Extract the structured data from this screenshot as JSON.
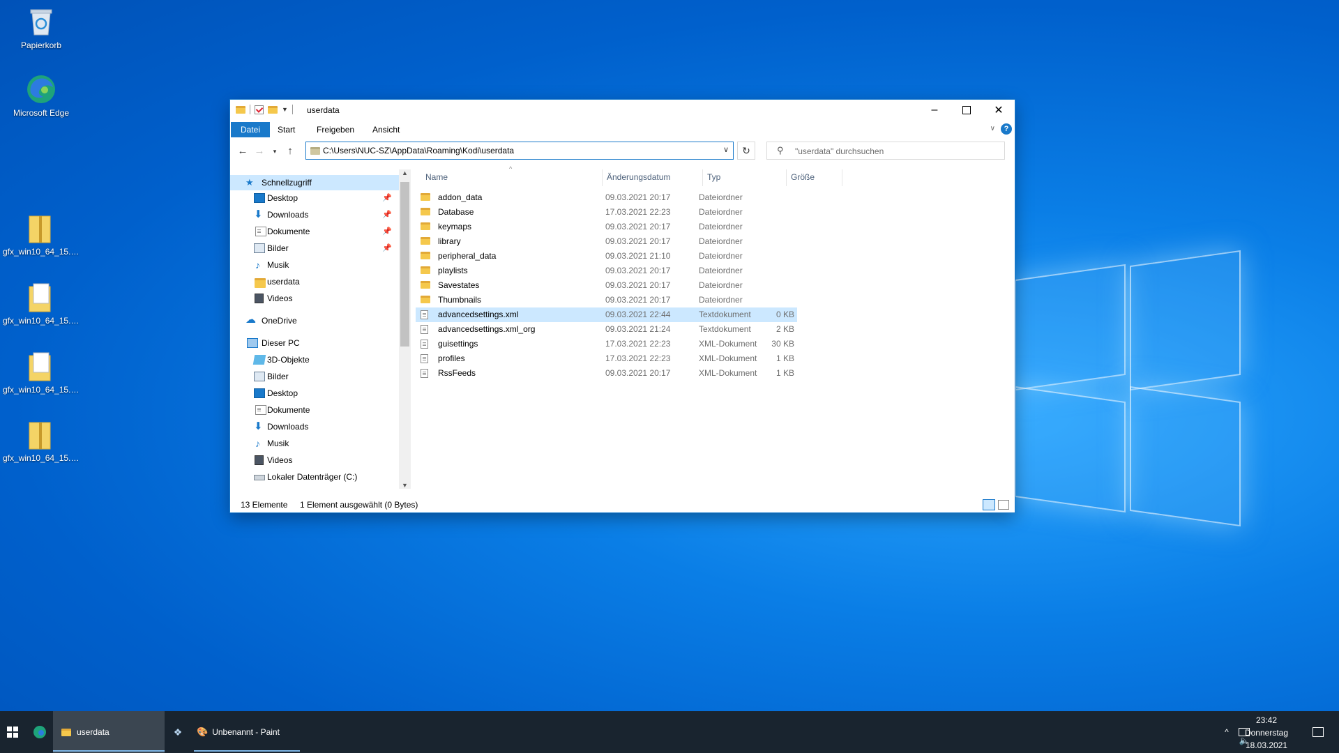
{
  "desktop": {
    "icons": [
      {
        "label": "Papierkorb",
        "icon": "recycle-bin-icon"
      },
      {
        "label": "Microsoft Edge",
        "icon": "edge-icon"
      },
      {
        "label": "gfx_win10_64_15.40...",
        "icon": "zip-folder-icon"
      },
      {
        "label": "gfx_win10_64_15.40...",
        "icon": "zip-folder-icon"
      },
      {
        "label": "gfx_win10_64_15.40...",
        "icon": "zip-folder-icon"
      },
      {
        "label": "gfx_win10_64_15.40...",
        "icon": "zip-folder-icon"
      }
    ]
  },
  "window": {
    "title": "userdata",
    "ribbon_tabs": [
      "Datei",
      "Start",
      "Freigeben",
      "Ansicht"
    ],
    "address": "C:\\Users\\NUC-SZ\\AppData\\Roaming\\Kodi\\userdata",
    "search_placeholder": "\"userdata\" durchsuchen",
    "nav": {
      "quick_access": "Schnellzugriff",
      "quick_items": [
        "Desktop",
        "Downloads",
        "Dokumente",
        "Bilder",
        "Musik",
        "userdata",
        "Videos"
      ],
      "onedrive": "OneDrive",
      "this_pc": "Dieser PC",
      "pc_items": [
        "3D-Objekte",
        "Bilder",
        "Desktop",
        "Dokumente",
        "Downloads",
        "Musik",
        "Videos",
        "Lokaler Datenträger (C:)"
      ]
    },
    "columns": {
      "name": "Name",
      "date": "Änderungsdatum",
      "type": "Typ",
      "size": "Größe"
    },
    "files": [
      {
        "name": "addon_data",
        "date": "09.03.2021 20:17",
        "type": "Dateiordner",
        "size": "",
        "kind": "folder"
      },
      {
        "name": "Database",
        "date": "17.03.2021 22:23",
        "type": "Dateiordner",
        "size": "",
        "kind": "folder"
      },
      {
        "name": "keymaps",
        "date": "09.03.2021 20:17",
        "type": "Dateiordner",
        "size": "",
        "kind": "folder"
      },
      {
        "name": "library",
        "date": "09.03.2021 20:17",
        "type": "Dateiordner",
        "size": "",
        "kind": "folder"
      },
      {
        "name": "peripheral_data",
        "date": "09.03.2021 21:10",
        "type": "Dateiordner",
        "size": "",
        "kind": "folder"
      },
      {
        "name": "playlists",
        "date": "09.03.2021 20:17",
        "type": "Dateiordner",
        "size": "",
        "kind": "folder"
      },
      {
        "name": "Savestates",
        "date": "09.03.2021 20:17",
        "type": "Dateiordner",
        "size": "",
        "kind": "folder"
      },
      {
        "name": "Thumbnails",
        "date": "09.03.2021 20:17",
        "type": "Dateiordner",
        "size": "",
        "kind": "folder"
      },
      {
        "name": "advancedsettings.xml",
        "date": "09.03.2021 22:44",
        "type": "Textdokument",
        "size": "0 KB",
        "kind": "text",
        "selected": true
      },
      {
        "name": "advancedsettings.xml_org",
        "date": "09.03.2021 21:24",
        "type": "Textdokument",
        "size": "2 KB",
        "kind": "text"
      },
      {
        "name": "guisettings",
        "date": "17.03.2021 22:23",
        "type": "XML-Dokument",
        "size": "30 KB",
        "kind": "xml"
      },
      {
        "name": "profiles",
        "date": "17.03.2021 22:23",
        "type": "XML-Dokument",
        "size": "1 KB",
        "kind": "xml"
      },
      {
        "name": "RssFeeds",
        "date": "09.03.2021 20:17",
        "type": "XML-Dokument",
        "size": "1 KB",
        "kind": "xml"
      }
    ],
    "status_count": "13 Elemente",
    "status_selected": "1 Element ausgewählt (0 Bytes)"
  },
  "taskbar": {
    "items": [
      {
        "label": "userdata"
      },
      {
        "label": "Unbenannt - Paint"
      }
    ],
    "time": "23:42",
    "day": "Donnerstag",
    "date": "18.03.2021"
  }
}
